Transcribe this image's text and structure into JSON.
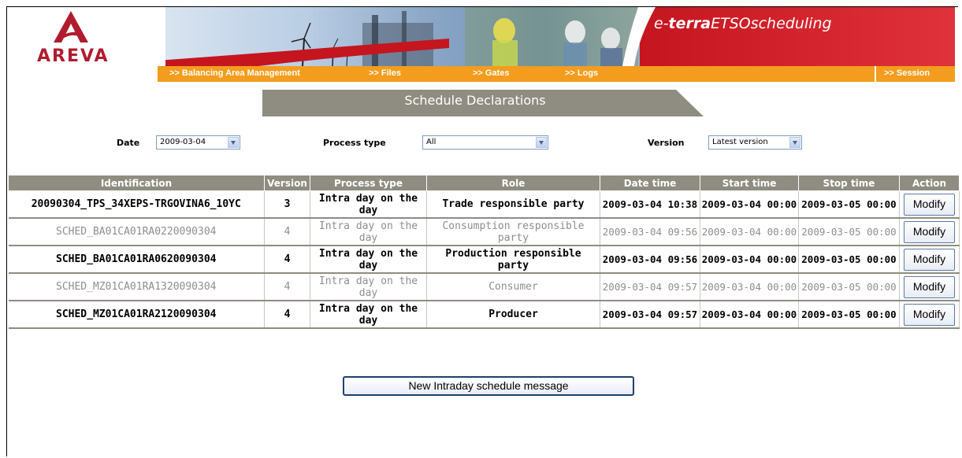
{
  "brand": {
    "logo_text": "AREVA",
    "product_prefix": "e-",
    "product_bold": "terra",
    "product_rest": "ETSOscheduling"
  },
  "nav": {
    "items": [
      {
        "label": ">> Balancing Area Management"
      },
      {
        "label": ">> Files"
      },
      {
        "label": ">> Gates"
      },
      {
        "label": ">> Logs"
      }
    ],
    "session": ">> Session"
  },
  "page_title": "Schedule Declarations",
  "filters": {
    "date_label": "Date",
    "date_value": "2009-03-04",
    "process_label": "Process type",
    "process_value": "All",
    "version_label": "Version",
    "version_value": "Latest version"
  },
  "table": {
    "columns": [
      "Identification",
      "Version",
      "Process type",
      "Role",
      "Date time",
      "Start time",
      "Stop time",
      "Action"
    ],
    "rows": [
      {
        "id": "20090304_TPS_34XEPS-TRGOVINA6_10YC",
        "version": "3",
        "process": "Intra day on the day",
        "role": "Trade responsible party",
        "datetime": "2009-03-04 10:38",
        "start": "2009-03-04 00:00",
        "stop": "2009-03-05 00:00",
        "action": "Modify",
        "style": "strong"
      },
      {
        "id": "SCHED_BA01CA01RA0220090304",
        "version": "4",
        "process": "Intra day on the day",
        "role": "Consumption responsible party",
        "datetime": "2009-03-04 09:56",
        "start": "2009-03-04 00:00",
        "stop": "2009-03-05 00:00",
        "action": "Modify",
        "style": "dim"
      },
      {
        "id": "SCHED_BA01CA01RA0620090304",
        "version": "4",
        "process": "Intra day on the day",
        "role": "Production responsible party",
        "datetime": "2009-03-04 09:56",
        "start": "2009-03-04 00:00",
        "stop": "2009-03-05 00:00",
        "action": "Modify",
        "style": "strong"
      },
      {
        "id": "SCHED_MZ01CA01RA1320090304",
        "version": "4",
        "process": "Intra day on the day",
        "role": "Consumer",
        "datetime": "2009-03-04 09:57",
        "start": "2009-03-04 00:00",
        "stop": "2009-03-05 00:00",
        "action": "Modify",
        "style": "dim"
      },
      {
        "id": "SCHED_MZ01CA01RA2120090304",
        "version": "4",
        "process": "Intra day on the day",
        "role": "Producer",
        "datetime": "2009-03-04 09:57",
        "start": "2009-03-04 00:00",
        "stop": "2009-03-05 00:00",
        "action": "Modify",
        "style": "strong"
      }
    ]
  },
  "new_button": "New Intraday schedule message",
  "colors": {
    "nav_orange": "#f39c1d",
    "brand_red": "#c5151f",
    "header_gray": "#8f8c81"
  }
}
